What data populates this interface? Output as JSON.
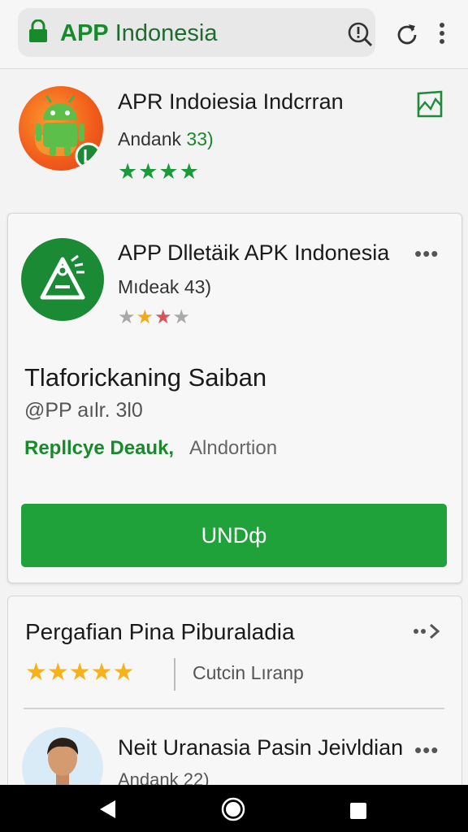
{
  "browser": {
    "url_brand": "APP",
    "url_rest": "Indonesia"
  },
  "featured_app": {
    "title": "APR Indoiesia Indcrran",
    "dev": "Andank",
    "dev_num": "33)",
    "rating": 4,
    "stars": "★★★★"
  },
  "app_card": {
    "title": "APP Dlletäik APK Indonesia",
    "dev": "Mıdeak 43)",
    "star_colors": [
      "#a9a9a9",
      "#f2a81d",
      "#d9535c",
      "#a9a9a9"
    ],
    "heading": "Tlaforickaning Saiban",
    "subheading": "@PP aılr. 3l0",
    "link_label": "Repllcye Deauk,",
    "secondary_label": "Alndortion",
    "button_label": "UNDф"
  },
  "review_section": {
    "title": "Pergafian Pina Piburaladia",
    "stars": "★★★★★",
    "sort_label": "Cutcin Lıranp",
    "reviewer_title": "Neit Uranasia Pasin Jeivldian",
    "reviewer_sub": "Andank 22)"
  },
  "icons": {
    "lock": "lock-icon",
    "search": "search-icon",
    "refresh": "refresh-icon",
    "menu": "overflow-menu-icon",
    "bookmark": "bookmark-icon",
    "back": "back-icon",
    "home": "home-icon",
    "recents": "recents-icon"
  },
  "colors": {
    "accent": "#20a23b",
    "brand_text": "#178a2c"
  }
}
